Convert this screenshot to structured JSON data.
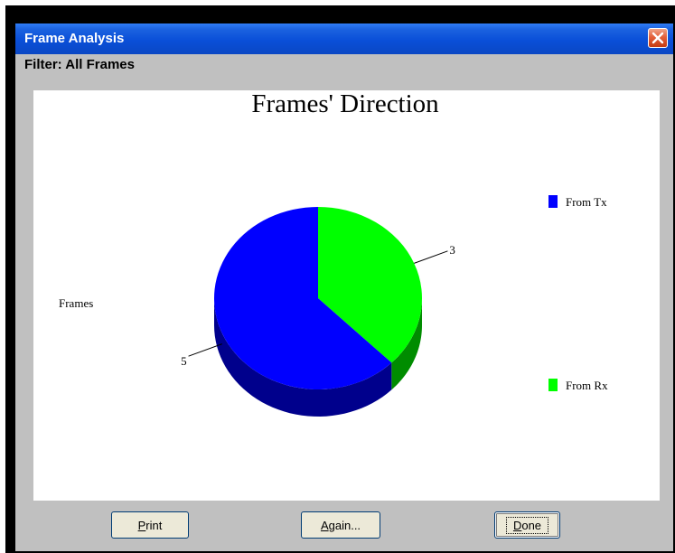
{
  "window": {
    "title": "Frame Analysis"
  },
  "filter": {
    "label": "Filter: All Frames"
  },
  "chart_data": {
    "type": "pie",
    "title": "Frames' Direction",
    "ylabel": "Frames",
    "series": [
      {
        "name": "From Tx",
        "value": 5,
        "color": "#0000ff"
      },
      {
        "name": "From Rx",
        "value": 3,
        "color": "#00ff00"
      }
    ],
    "legend_position": "right",
    "style": "3d"
  },
  "buttons": {
    "print": {
      "key": "P",
      "rest": "rint"
    },
    "again": {
      "key": "A",
      "rest": "gain..."
    },
    "done": {
      "key": "D",
      "rest": "one"
    }
  }
}
